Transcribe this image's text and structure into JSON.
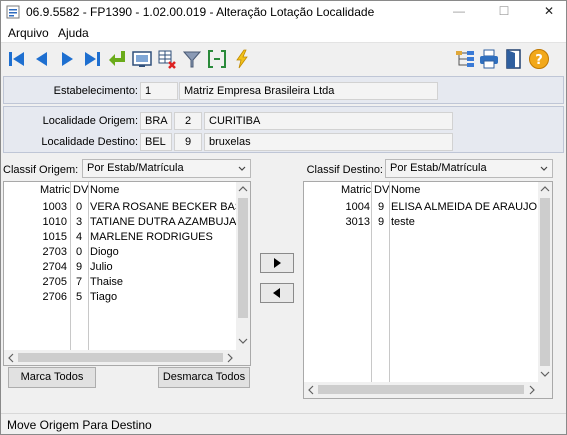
{
  "window": {
    "title": "06.9.5582 - FP1390 - 1.02.00.019 - Alteração Lotação Localidade",
    "minimize": "—",
    "maximize": "☐",
    "close": "✕"
  },
  "menu": {
    "items": [
      "Arquivo",
      "Ajuda"
    ]
  },
  "toolbar": {
    "left_icons": [
      "first-record-icon",
      "previous-record-icon",
      "next-record-icon",
      "last-record-icon",
      "return-icon",
      "screen-icon",
      "table-sync-icon",
      "filter-icon",
      "bracket-select-icon",
      "lightning-icon"
    ],
    "right_icons": [
      "tree-icon",
      "printer-icon",
      "exit-door-icon",
      "help-icon"
    ]
  },
  "estabelecimento": {
    "label": "Estabelecimento:",
    "code": "1",
    "name": "Matriz Empresa Brasileira Ltda"
  },
  "localidade_origem": {
    "label": "Localidade Origem:",
    "uf": "BRA",
    "code": "2",
    "name": "CURITIBA"
  },
  "localidade_destino": {
    "label": "Localidade Destino:",
    "uf": "BEL",
    "code": "9",
    "name": "bruxelas"
  },
  "origem": {
    "classif_label": "Classif Origem:",
    "classif_value": "Por Estab/Matrícula",
    "headers": {
      "matric": "Matric",
      "dv": "DV",
      "nome": "Nome"
    },
    "rows": [
      {
        "matric": "1003",
        "dv": "0",
        "nome": "VERA ROSANE BECKER BAST"
      },
      {
        "matric": "1010",
        "dv": "3",
        "nome": "TATIANE DUTRA AZAMBUJA"
      },
      {
        "matric": "1015",
        "dv": "4",
        "nome": "MARLENE RODRIGUES"
      },
      {
        "matric": "2703",
        "dv": "0",
        "nome": "Diogo"
      },
      {
        "matric": "2704",
        "dv": "9",
        "nome": "Julio"
      },
      {
        "matric": "2705",
        "dv": "7",
        "nome": "Thaise"
      },
      {
        "matric": "2706",
        "dv": "5",
        "nome": "Tiago"
      }
    ],
    "marca_todos": "Marca Todos",
    "desmarca_todos": "Desmarca Todos"
  },
  "destino": {
    "classif_label": "Classif Destino:",
    "classif_value": "Por Estab/Matrícula",
    "headers": {
      "matric": "Matric",
      "dv": "DV",
      "nome": "Nome"
    },
    "rows": [
      {
        "matric": "1004",
        "dv": "9",
        "nome": "ELISA ALMEIDA DE ARAUJO"
      },
      {
        "matric": "3013",
        "dv": "9",
        "nome": "teste"
      }
    ]
  },
  "status": {
    "text": "Move Origem Para Destino"
  }
}
